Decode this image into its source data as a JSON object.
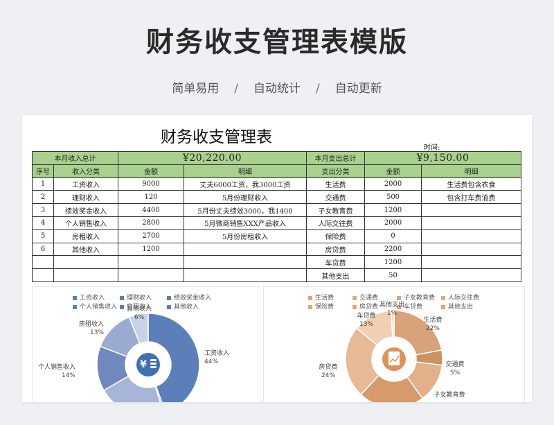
{
  "banner": {
    "title": "财务收支管理表模版",
    "tags": [
      "简单易用",
      "自动统计",
      "自动更新"
    ],
    "separator": "/"
  },
  "sheet": {
    "title": "财务收支管理表",
    "time_label": "时间:",
    "income_total_label": "本月收入总计",
    "income_total_value": "¥20,220.00",
    "expense_total_label": "本月支出总计",
    "expense_total_value": "¥9,150.00",
    "headers": [
      "序号",
      "收入分类",
      "金额",
      "明细",
      "支出分类",
      "金额",
      "明细"
    ],
    "rows": [
      [
        "1",
        "工资收入",
        "9000",
        "丈夫6000工资，我3000工资",
        "生活费",
        "2000",
        "生活费包含衣食"
      ],
      [
        "2",
        "理财收入",
        "120",
        "5月份理财收入",
        "交通费",
        "500",
        "包含打车费油费"
      ],
      [
        "3",
        "绩效奖金收入",
        "4400",
        "5月份丈夫绩效3000，我1400",
        "子女教育费",
        "1200",
        ""
      ],
      [
        "4",
        "个人销售收入",
        "2800",
        "5月微商销售XXX产品收入",
        "人际交往费",
        "2000",
        ""
      ],
      [
        "5",
        "房租收入",
        "2700",
        "5月份房租收入",
        "保险费",
        "0",
        ""
      ],
      [
        "6",
        "其他收入",
        "1200",
        "",
        "房贷费",
        "2200",
        ""
      ],
      [
        "",
        "",
        "",
        "",
        "车贷费",
        "1200",
        ""
      ],
      [
        "",
        "",
        "",
        "",
        "其他支出",
        "50",
        ""
      ]
    ]
  },
  "income_chart": {
    "legend": [
      "工资收入",
      "理财收入",
      "绩效奖金收入",
      "个人销售收入",
      "房租收入",
      "其他收入"
    ],
    "colors": {
      "legend_swatch": "#5b7fb8",
      "slice_1": "#5b7fb8",
      "slice_2": "#7f97c4",
      "slice_3": "#a7b6d8",
      "slice_4": "#6f89bd",
      "slice_5": "#9aabd0",
      "slice_6": "#c8d2e6",
      "center": "#3f6fb5"
    },
    "labels": [
      {
        "name": "工资收入",
        "pct": "44%"
      },
      {
        "name": "个人销售收入",
        "pct": "14%"
      },
      {
        "name": "房租收入",
        "pct": "13%"
      },
      {
        "name": "其他收入",
        "pct": "6%"
      }
    ],
    "center_icon": "yen-coins-icon"
  },
  "expense_chart": {
    "legend": [
      "生活费",
      "交通费",
      "子女教育费",
      "人际交往费",
      "保险费",
      "房贷费",
      "车贷费",
      "其他支出"
    ],
    "colors": {
      "legend_swatch": "#e0a57c",
      "slice_1": "#d8a27a",
      "slice_2": "#c9925f",
      "slice_3": "#e2b08a",
      "slice_4": "#d79a6b",
      "slice_5": "#efc7a6",
      "slice_6": "#e7b995",
      "slice_7": "#f0cfb3",
      "slice_8": "#f5dcc8",
      "center": "#e0915a"
    },
    "labels": [
      {
        "name": "生活费",
        "pct": "22%"
      },
      {
        "name": "交通费",
        "pct": "5%"
      },
      {
        "name": "子女教育费",
        "pct": ""
      },
      {
        "name": "房贷费",
        "pct": "24%"
      },
      {
        "name": "车贷费",
        "pct": "13%"
      },
      {
        "name": "其他支出",
        "pct": "1%"
      }
    ],
    "center_icon": "money-chart-icon"
  }
}
